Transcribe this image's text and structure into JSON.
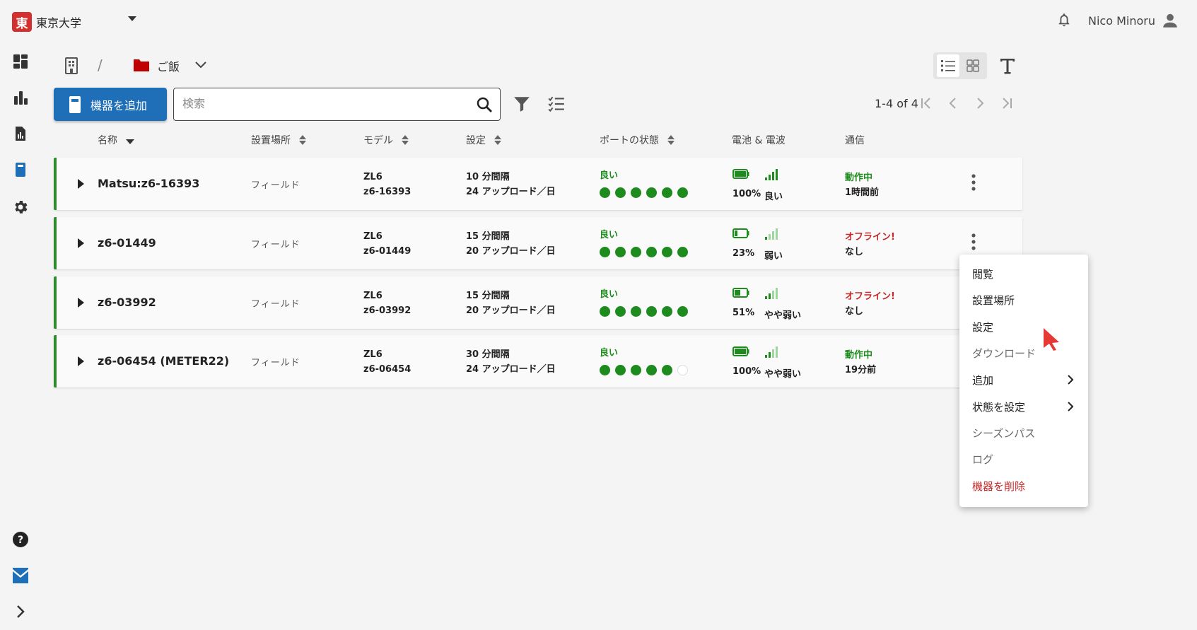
{
  "org": {
    "logo_char": "東",
    "name": "東京大学"
  },
  "user": {
    "name": "Nico Minoru"
  },
  "breadcrumb": {
    "separator": "/",
    "folder": "ご飯"
  },
  "toolbar": {
    "add_label": "機器を追加",
    "search_placeholder": "検索",
    "pager": "1-4 of 4"
  },
  "table": {
    "headers": {
      "name": "名称",
      "location": "設置場所",
      "model": "モデル",
      "settings": "設定",
      "port": "ポートの状態",
      "battery": "電池 & 電波",
      "comm": "通信"
    },
    "rows": [
      {
        "name": "Matsu:z6-16393",
        "location": "フィールド",
        "model": "ZL6",
        "serial": "z6-16393",
        "interval": "10 分間隔",
        "uploads": "24 アップロード／日",
        "port_status": "良い",
        "ports_ok": 6,
        "battery": "100%",
        "signal": "良い",
        "signal_bars": 4,
        "comm_status": "動作中",
        "comm_ok": true,
        "comm_time": "1時間前"
      },
      {
        "name": "z6-01449",
        "location": "フィールド",
        "model": "ZL6",
        "serial": "z6-01449",
        "interval": "15 分間隔",
        "uploads": "20 アップロード／日",
        "port_status": "良い",
        "ports_ok": 6,
        "battery": "23%",
        "signal": "弱い",
        "signal_bars": 1,
        "comm_status": "オフライン!",
        "comm_ok": false,
        "comm_time": "なし"
      },
      {
        "name": "z6-03992",
        "location": "フィールド",
        "model": "ZL6",
        "serial": "z6-03992",
        "interval": "15 分間隔",
        "uploads": "20 アップロード／日",
        "port_status": "良い",
        "ports_ok": 6,
        "battery": "51%",
        "signal": "やや弱い",
        "signal_bars": 2,
        "comm_status": "オフライン!",
        "comm_ok": false,
        "comm_time": "なし"
      },
      {
        "name": "z6-06454 (METER22)",
        "location": "フィールド",
        "model": "ZL6",
        "serial": "z6-06454",
        "interval": "30 分間隔",
        "uploads": "24 アップロード／日",
        "port_status": "良い",
        "ports_ok": 5,
        "battery": "100%",
        "signal": "やや弱い",
        "signal_bars": 2,
        "comm_status": "動作中",
        "comm_ok": true,
        "comm_time": "19分前"
      }
    ]
  },
  "menu": {
    "view": "閲覧",
    "location": "設置場所",
    "settings": "設定",
    "download": "ダウンロード",
    "add": "追加",
    "set_status": "状態を設定",
    "season_pass": "シーズンパス",
    "log": "ログ",
    "delete": "機器を削除"
  },
  "colors": {
    "accent": "#1e6fb8",
    "ok": "#1d8b1d",
    "offline": "#c62828",
    "row_border": "#2e8b2e",
    "org_red": "#d32f2f"
  }
}
